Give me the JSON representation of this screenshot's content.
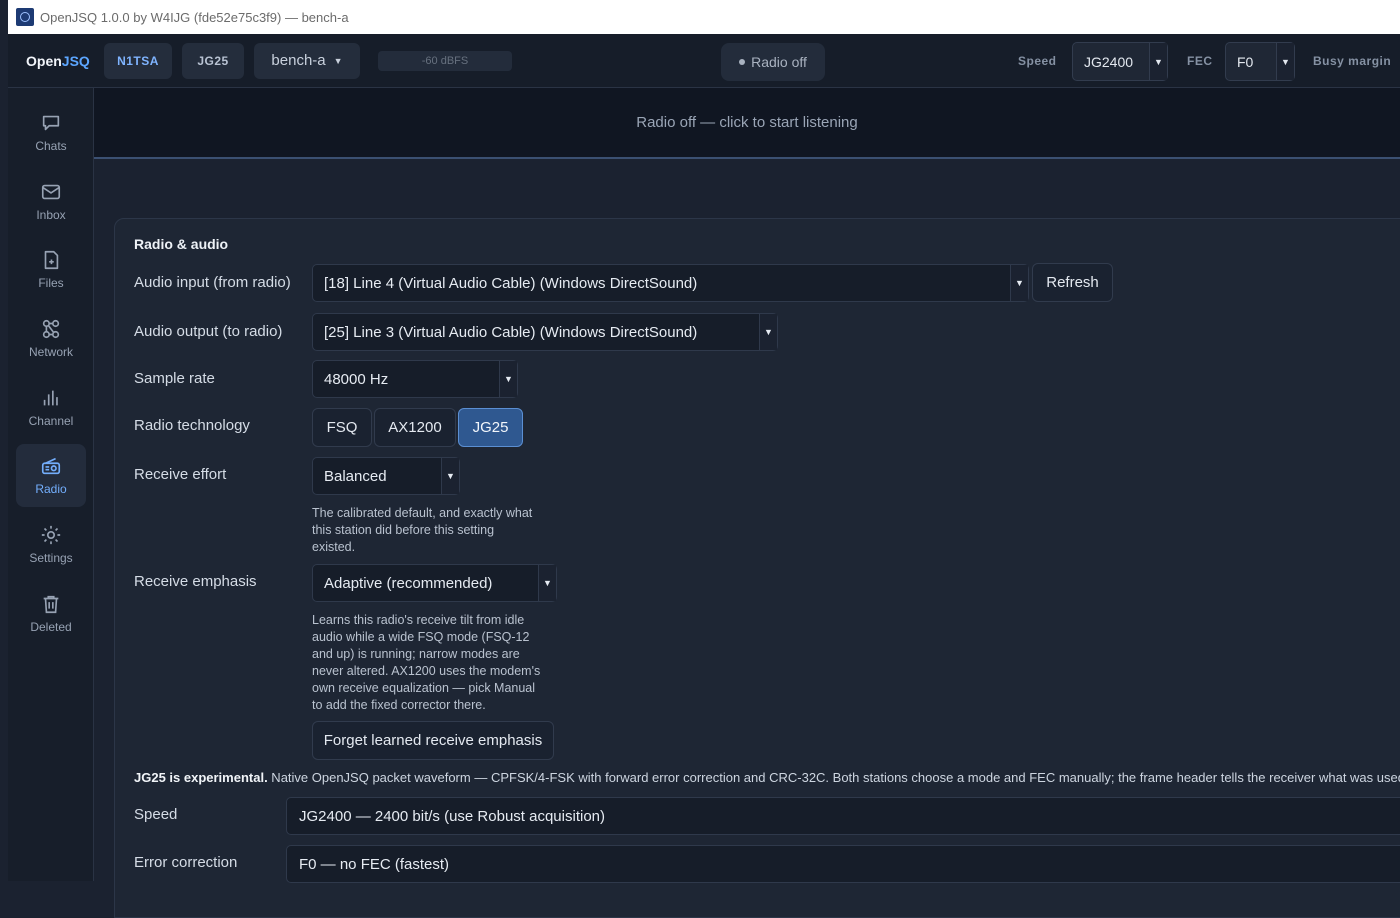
{
  "window": {
    "title": "OpenJSQ 1.0.0 by W4IJG (fde52e75c3f9) — bench-a"
  },
  "topbar": {
    "brand_open": "Open",
    "brand_jsq": "JSQ",
    "callsign": "N1TSA",
    "technology": "JG25",
    "station": "bench-a",
    "level": "-60 dBFS",
    "radio_status": "Radio off",
    "speed_label": "Speed",
    "speed_value": "JG2400",
    "fec_label": "FEC",
    "fec_value": "F0",
    "busy_margin_label": "Busy margin"
  },
  "sidebar": {
    "items": [
      {
        "label": "Chats",
        "icon": "chat-icon"
      },
      {
        "label": "Inbox",
        "icon": "inbox-icon"
      },
      {
        "label": "Files",
        "icon": "file-icon"
      },
      {
        "label": "Network",
        "icon": "network-icon"
      },
      {
        "label": "Channel",
        "icon": "bars-icon"
      },
      {
        "label": "Radio",
        "icon": "radio-icon",
        "active": true
      },
      {
        "label": "Settings",
        "icon": "gear-icon"
      },
      {
        "label": "Deleted",
        "icon": "trash-icon"
      }
    ]
  },
  "banner": {
    "text": "Radio off — click to start listening"
  },
  "settings": {
    "section_title": "Radio & audio",
    "audio_input": {
      "label": "Audio input (from radio)",
      "value": "[18] Line 4 (Virtual Audio Cable) (Windows DirectSound)",
      "refresh_label": "Refresh"
    },
    "audio_output": {
      "label": "Audio output (to radio)",
      "value": "[25] Line 3 (Virtual Audio Cable) (Windows DirectSound)"
    },
    "sample_rate": {
      "label": "Sample rate",
      "value": "48000 Hz"
    },
    "radio_technology": {
      "label": "Radio technology",
      "options": [
        "FSQ",
        "AX1200",
        "JG25"
      ],
      "selected": "JG25"
    },
    "receive_effort": {
      "label": "Receive effort",
      "value": "Balanced",
      "help": [
        "The calibrated default, and exactly what",
        "this station did before this setting",
        "existed."
      ]
    },
    "receive_emphasis": {
      "label": "Receive emphasis",
      "value": "Adaptive (recommended)",
      "help": [
        "Learns this radio's receive tilt from idle",
        "audio while a wide FSQ mode (FSQ-12",
        "and up) is running; narrow modes are",
        "never altered. AX1200 uses the modem's",
        "own receive equalization — pick Manual",
        "to add the fixed corrector there."
      ],
      "forget_label": "Forget learned receive emphasis"
    },
    "jg25_notice_bold": "JG25 is experimental.",
    "jg25_notice_text": " Native OpenJSQ packet waveform — CPFSK/4-FSK with forward error correction and CRC-32C. Both stations choose a mode and FEC manually; the frame header tells the receiver what was used, so receive follo",
    "speed": {
      "label": "Speed",
      "value": "JG2400 — 2400 bit/s (use Robust acquisition)"
    },
    "error_correction": {
      "label": "Error correction",
      "value": "F0 — no FEC (fastest)"
    }
  }
}
